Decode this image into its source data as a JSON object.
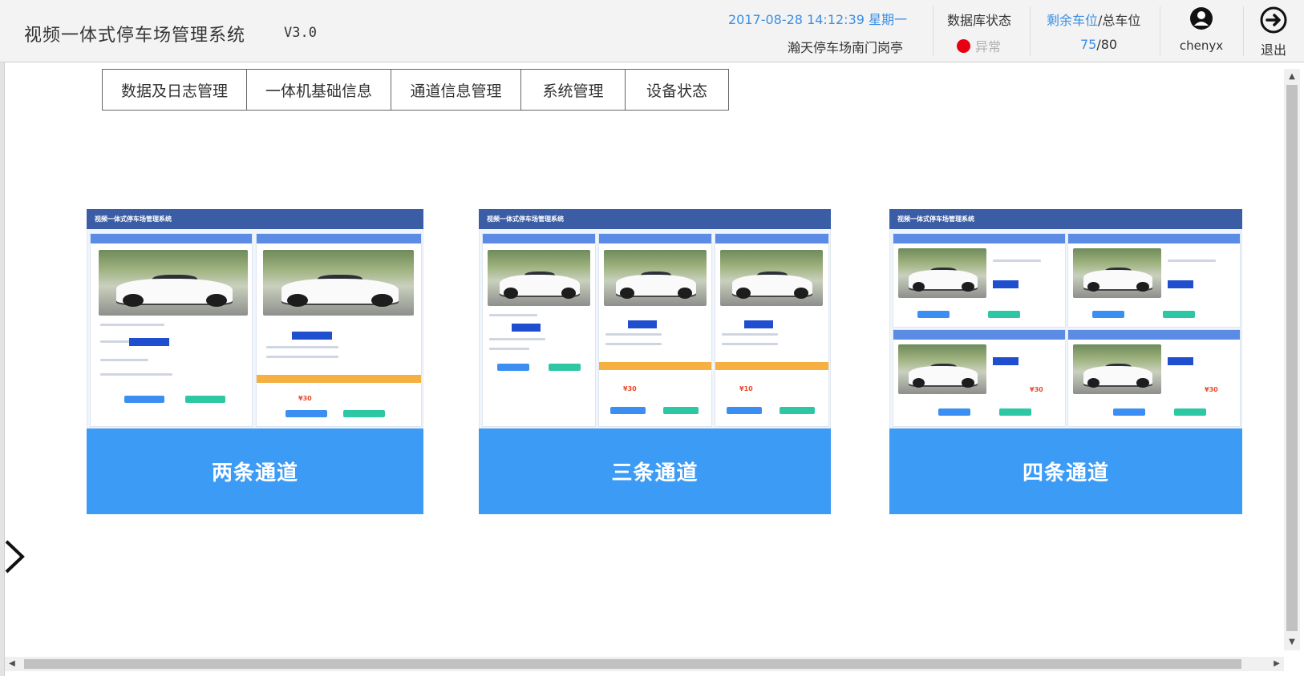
{
  "header": {
    "title": "视频一体式停车场管理系统",
    "version": "V3.0",
    "datetime": "2017-08-28 14:12:39 星期一",
    "location": "瀚天停车场南门岗亭",
    "db_status_label": "数据库状态",
    "db_status_value": "异常",
    "db_status_color": "#e60012",
    "spaces_remaining_label": "剩余车位",
    "spaces_separator": "/",
    "spaces_total_label": "总车位",
    "spaces_remaining": "75",
    "spaces_total": "/80",
    "username": "chenyx",
    "logout_label": "退出",
    "user_icon": "user-icon",
    "logout_icon": "logout-arrow-icon"
  },
  "tabs": [
    {
      "label": "数据及日志管理"
    },
    {
      "label": "一体机基础信息"
    },
    {
      "label": "通道信息管理"
    },
    {
      "label": "系统管理"
    },
    {
      "label": "设备状态"
    }
  ],
  "cards": [
    {
      "label": "两条通道",
      "preview_title": "视频一体式停车场管理系统"
    },
    {
      "label": "三条通道",
      "preview_title": "视频一体式停车场管理系统"
    },
    {
      "label": "四条通道",
      "preview_title": "视频一体式停车场管理系统"
    }
  ],
  "colors": {
    "accent": "#3c9bf5",
    "link_blue": "#3a8ee6",
    "preview_header": "#3b5da6"
  }
}
